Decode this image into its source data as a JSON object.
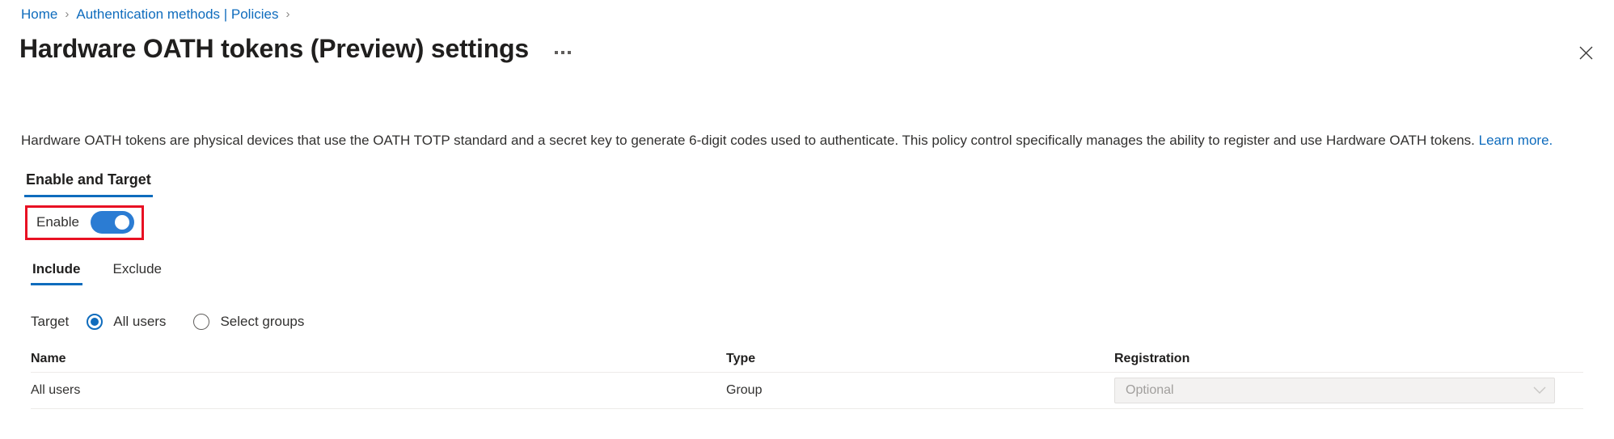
{
  "breadcrumb": {
    "items": [
      {
        "label": "Home"
      },
      {
        "label": "Authentication methods | Policies"
      }
    ],
    "separator": "›"
  },
  "header": {
    "title": "Hardware OATH tokens (Preview) settings",
    "more_label": "More commands",
    "close_label": "Close"
  },
  "description": {
    "text": "Hardware OATH tokens are physical devices that use the OATH TOTP standard and a secret key to generate 6-digit codes used to authenticate. This policy control specifically manages the ability to register and use Hardware OATH tokens.",
    "link_label": "Learn more."
  },
  "pivot": {
    "tabs": [
      {
        "label": "Enable and Target",
        "active": true
      }
    ]
  },
  "enable": {
    "label": "Enable",
    "state": "on",
    "highlight_color": "#e81123",
    "toggle_color": "#2b7cd3"
  },
  "subpivot": {
    "tabs": [
      {
        "label": "Include",
        "active": true
      },
      {
        "label": "Exclude",
        "active": false
      }
    ]
  },
  "target": {
    "label": "Target",
    "options": [
      {
        "label": "All users",
        "checked": true
      },
      {
        "label": "Select groups",
        "checked": false
      }
    ]
  },
  "table": {
    "columns": [
      "Name",
      "Type",
      "Registration"
    ],
    "rows": [
      {
        "name": "All users",
        "type": "Group",
        "registration": "Optional"
      }
    ]
  },
  "colors": {
    "accent": "#0f6cbd",
    "link": "#0f6cbd",
    "toggle_on": "#2b7cd3",
    "annotation": "#e81123",
    "text": "#323130",
    "muted": "#a19f9d",
    "divider": "#edebe9"
  }
}
